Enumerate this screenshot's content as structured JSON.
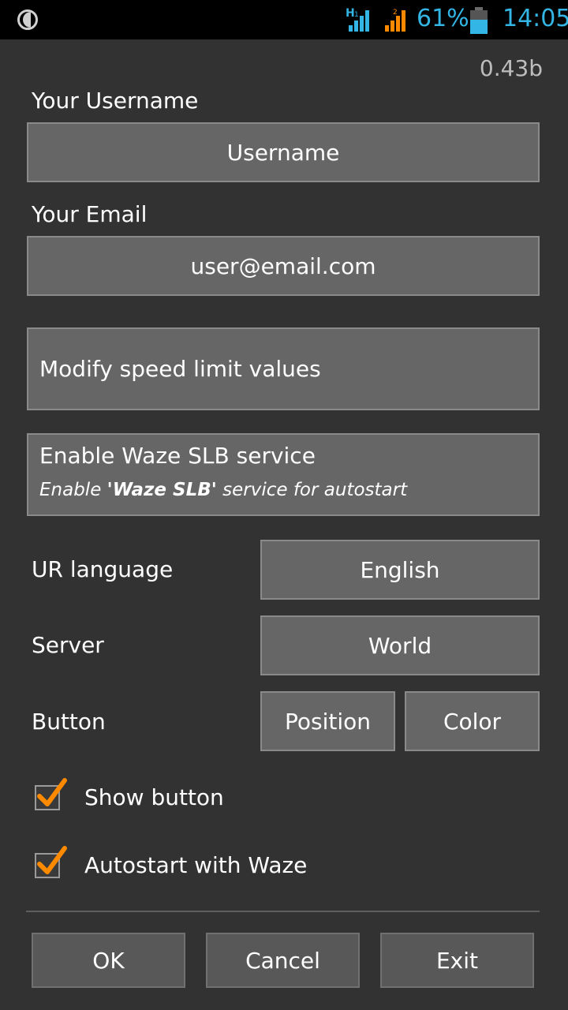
{
  "status_bar": {
    "battery_percent": "61%",
    "battery_level": 0.61,
    "time": "14:05",
    "accent_color": "#33b5e5",
    "signal2_color": "#ff8a00"
  },
  "version": "0.43b",
  "username": {
    "label": "Your Username",
    "value": "Username"
  },
  "email": {
    "label": "Your Email",
    "value": "user@email.com"
  },
  "speed_limit": {
    "label": "Modify speed limit values"
  },
  "slb_service": {
    "title": "Enable Waze SLB service",
    "subtitle_pre": "Enable ",
    "subtitle_bold": "'Waze SLB'",
    "subtitle_post": " service for autostart"
  },
  "ur_language": {
    "label": "UR language",
    "value": "English"
  },
  "server": {
    "label": "Server",
    "value": "World"
  },
  "button_row": {
    "label": "Button",
    "position": "Position",
    "color": "Color"
  },
  "checkboxes": [
    {
      "label": "Show button",
      "checked": true
    },
    {
      "label": "Autostart with Waze",
      "checked": true
    }
  ],
  "actions": {
    "ok": "OK",
    "cancel": "Cancel",
    "exit": "Exit"
  }
}
